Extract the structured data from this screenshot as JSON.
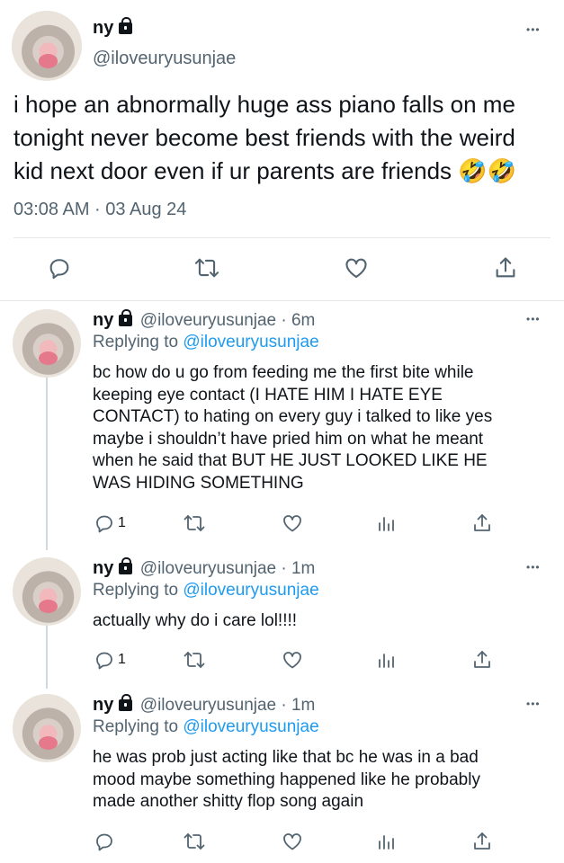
{
  "main_tweet": {
    "name": "ny",
    "handle": "@iloveuryusunjae",
    "lines": [
      "i hope an abnormally huge ass piano falls on me",
      "tonight never become best friends with the weird",
      "kid next door even if ur parents are friends 🤣🤣"
    ],
    "timestamp": "03:08 AM · 03 Aug 24",
    "more": "•••"
  },
  "replies": [
    {
      "name": "ny",
      "handle_time": "@iloveuryusunjae · 6m",
      "replying_prefix": "Replying to ",
      "replying_to": "@iloveuryusunjae",
      "lines": [
        "bc how do u go from feeding me the first bite while",
        "keeping eye contact (I HATE HIM I HATE EYE",
        "CONTACT) to hating on every guy i talked to like yes",
        "maybe i shouldn’t have pried him on what he meant",
        "when he said that BUT HE JUST LOOKED LIKE HE",
        "WAS HIDING SOMETHING"
      ],
      "reply_count": "1",
      "more": "•••"
    },
    {
      "name": "ny",
      "handle_time": "@iloveuryusunjae · 1m",
      "replying_prefix": "Replying to ",
      "replying_to": "@iloveuryusunjae",
      "lines": [
        "actually why do i care lol!!!!"
      ],
      "reply_count": "1",
      "more": "•••"
    },
    {
      "name": "ny",
      "handle_time": "@iloveuryusunjae · 1m",
      "replying_prefix": "Replying to ",
      "replying_to": "@iloveuryusunjae",
      "lines": [
        "he was prob just acting like that bc he was in a bad",
        "mood maybe something happened like he probably",
        "made another shitty flop song again"
      ],
      "reply_count": "",
      "more": "•••"
    }
  ]
}
